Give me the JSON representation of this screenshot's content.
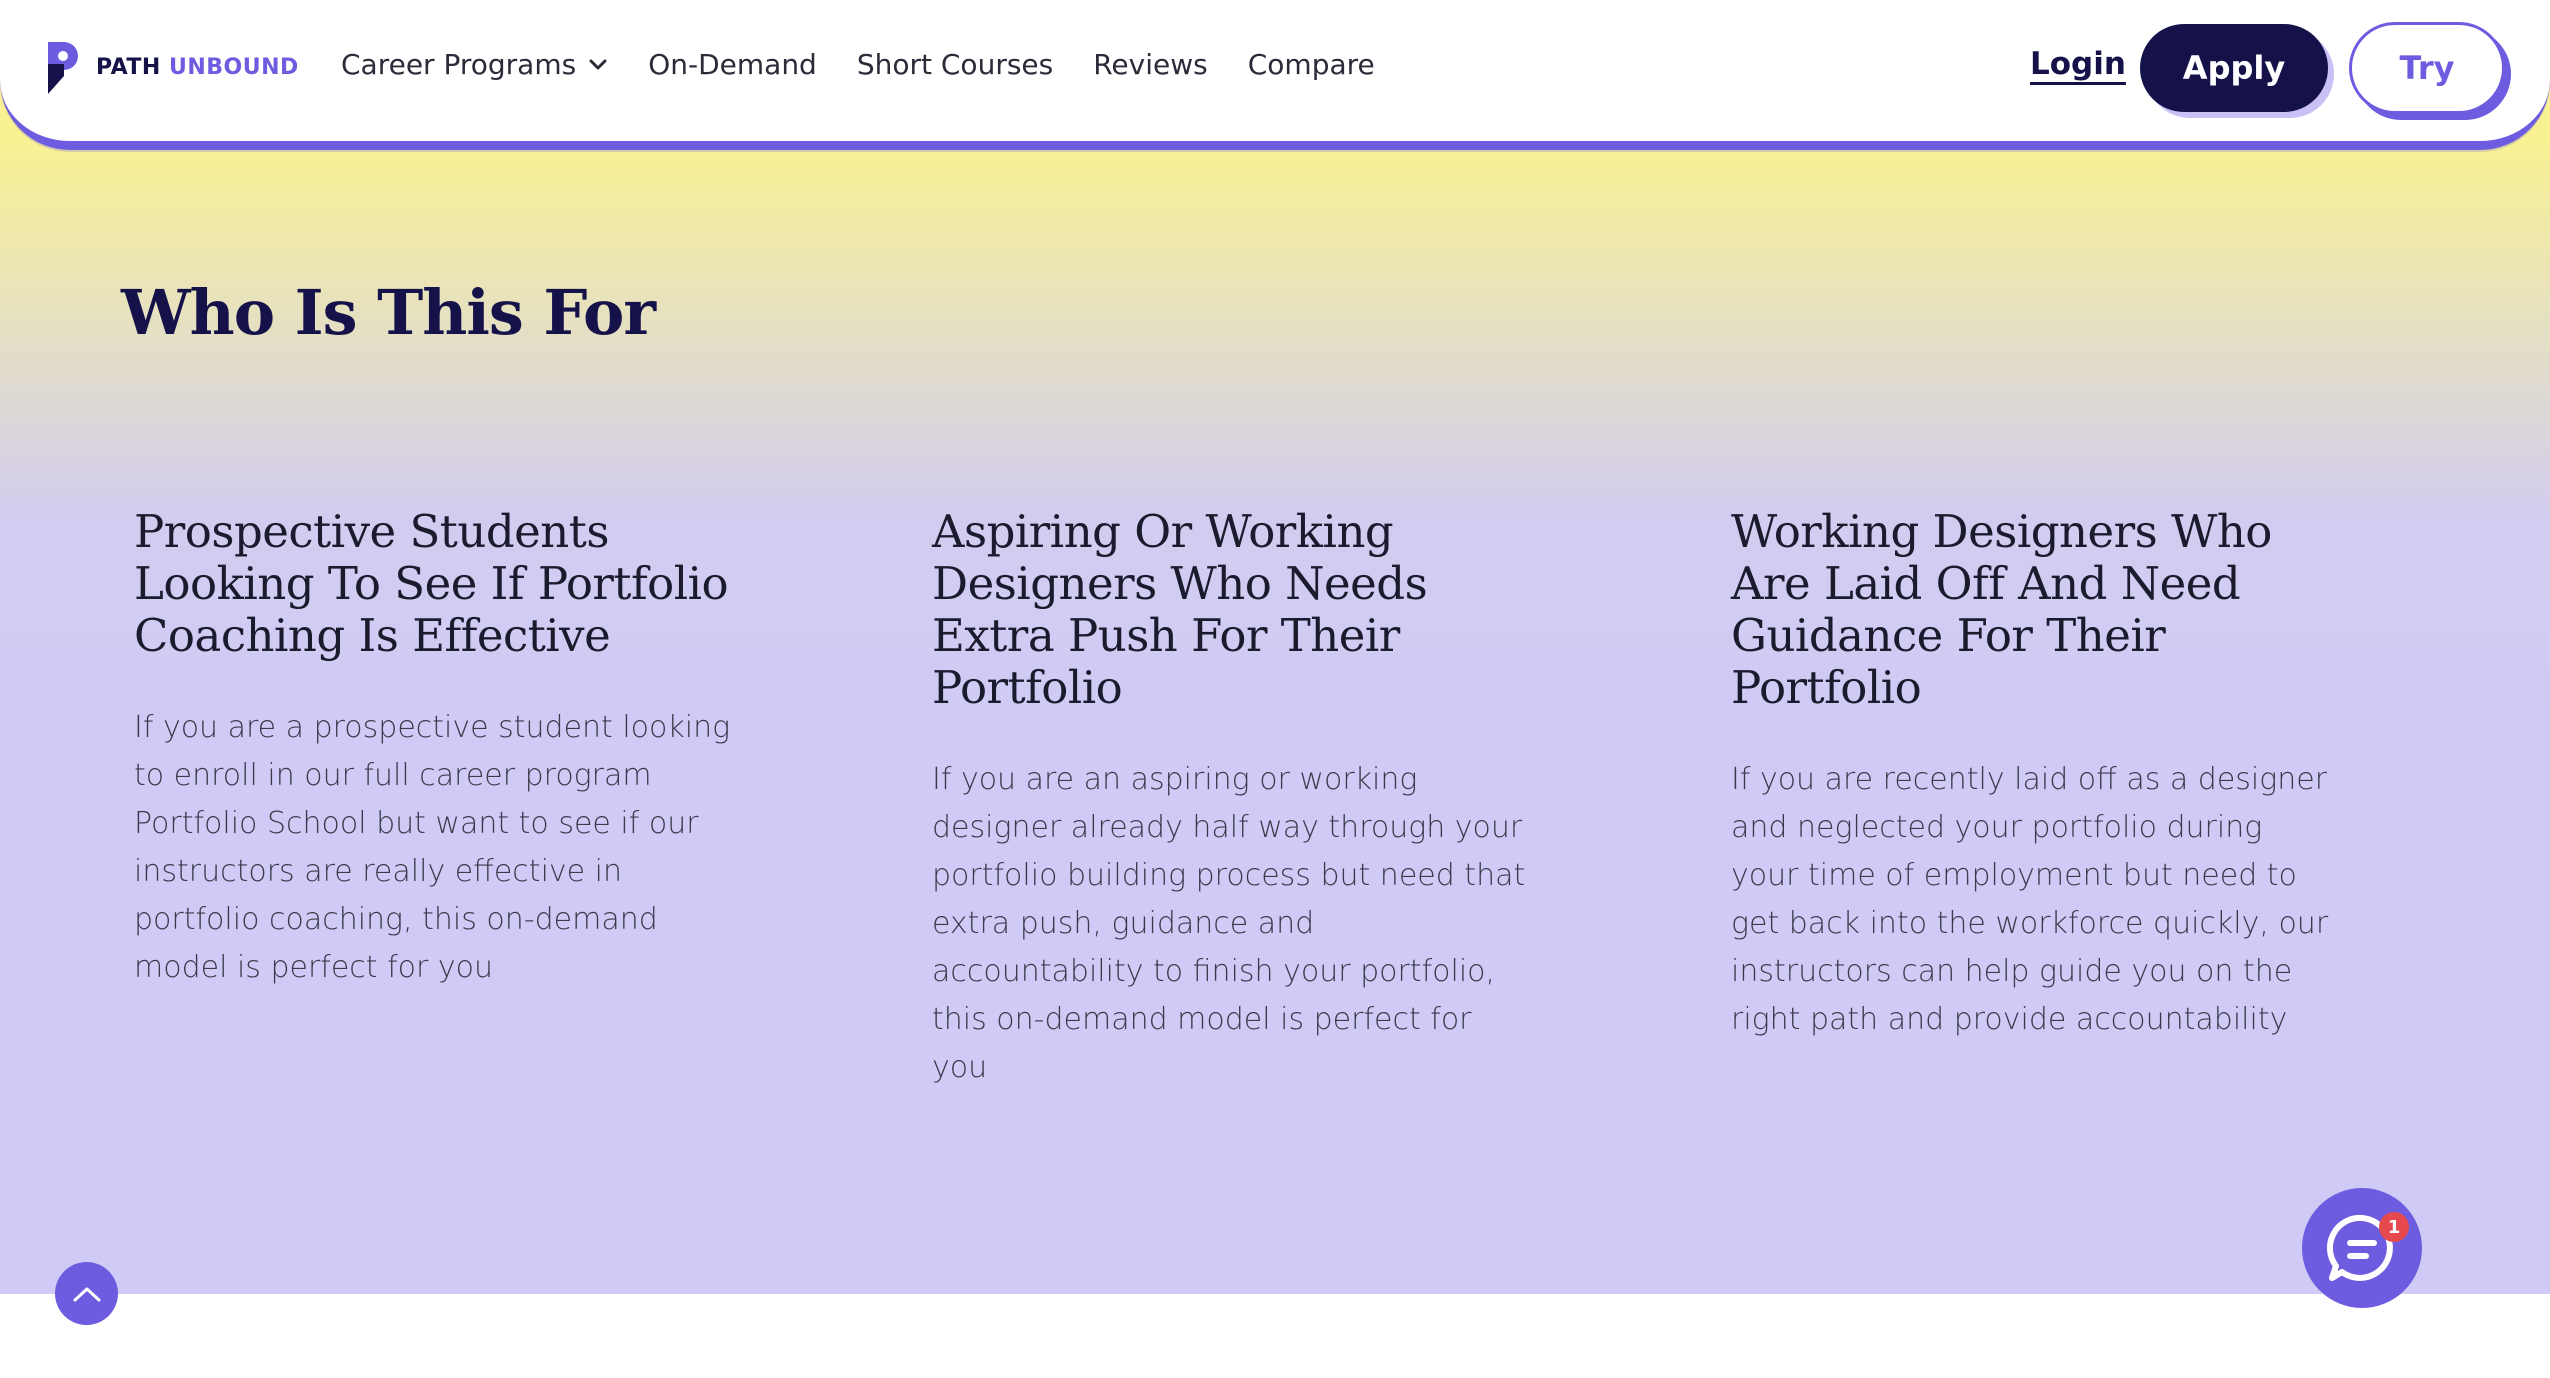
{
  "brand": {
    "name_part1": "PATH",
    "name_part2": "UNBOUND",
    "primary_color": "#15124a",
    "accent_color": "#6d5ce0"
  },
  "nav": {
    "items": [
      {
        "label": "Career Programs",
        "has_dropdown": true
      },
      {
        "label": "On-Demand"
      },
      {
        "label": "Short Courses"
      },
      {
        "label": "Reviews"
      },
      {
        "label": "Compare"
      }
    ],
    "login_label": "Login",
    "apply_label": "Apply",
    "try_label": "Try"
  },
  "section": {
    "title": "Who Is This For",
    "cards": [
      {
        "heading": "Prospective Students Looking To See If Portfolio Coaching Is Effective",
        "body": "If you are a prospective student looking to enroll in our full career program Portfolio School but want to see if our instructors are really effective in portfolio coaching, this on-demand model is perfect for you"
      },
      {
        "heading": "Aspiring Or Working Designers Who Needs Extra Push For Their Portfolio",
        "body": "If you are an aspiring or working designer already half way through your portfolio building process but need that extra push, guidance and accountability to finish your portfolio, this on-demand model is perfect for you"
      },
      {
        "heading": "Working Designers Who Are Laid Off And Need Guidance For Their Portfolio",
        "body": "If you are recently laid off as a designer and neglected your portfolio during your time of employment but need to get back into the workforce quickly, our instructors can help guide you on the right path and provide accountability"
      }
    ]
  },
  "widgets": {
    "scroll_top_icon": "chevron-up-icon",
    "chat_icon": "chat-bubble-icon",
    "chat_badge_count": "1"
  }
}
